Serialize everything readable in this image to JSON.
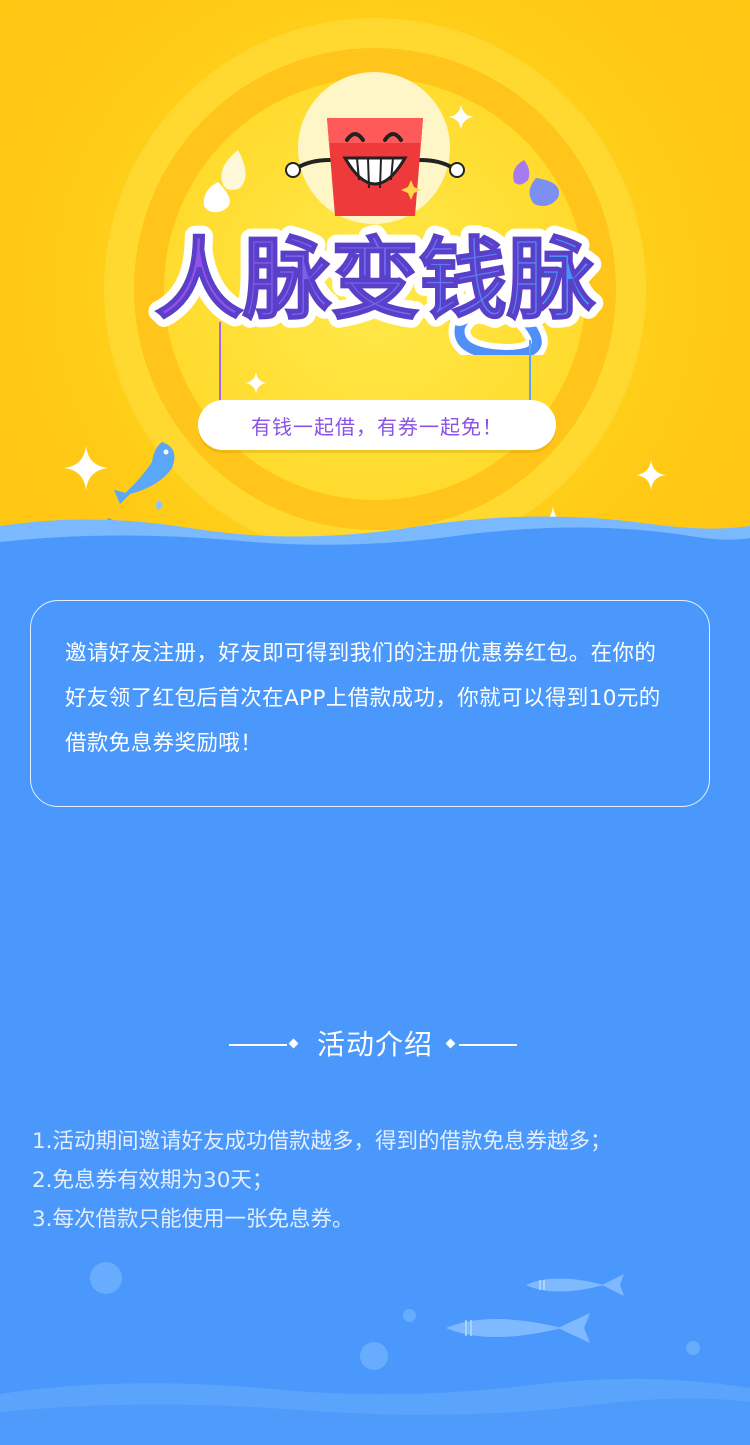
{
  "hero": {
    "title": "人脉变钱脉",
    "slogan": "有钱一起借，有券一起免！"
  },
  "intro": {
    "text": "邀请好友注册，好友即可得到我们的注册优惠券红包。在你的好友领了红包后首次在APP上借款成功，你就可以得到10元的借款免息券奖励哦！"
  },
  "activity": {
    "heading": "活动介绍",
    "rules": [
      "1.活动期间邀请好友成功借款越多，得到的借款免息券越多；",
      "2.免息券有效期为30天；",
      "3.每次借款只能使用一张免息券。"
    ]
  },
  "colors": {
    "hero_yellow": "#ffc815",
    "page_blue": "#4a98fb",
    "title_purple": "#8a4fe6",
    "title_blue": "#4f8ff7",
    "slogan_purple": "#8a52e8",
    "mascot_red": "#ee3a3a"
  },
  "icons": [
    "mascot-red-packet-icon",
    "sparkle-icon",
    "water-drop-icon",
    "jumping-fish-icon",
    "swimming-fish-icon",
    "bubble-icon"
  ]
}
